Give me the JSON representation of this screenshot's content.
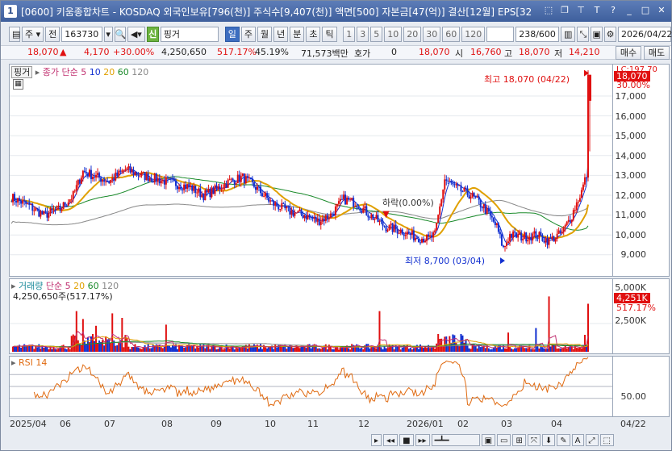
{
  "window": {
    "number": "1",
    "title": "[0600] 키움종합차트 - KOSDAQ 외국인보유[796(천)] 주식수[9,407(천)] 액면[500] 자본금[47(억)] 결산[12월] EPS[32"
  },
  "toolbar": {
    "period_type": "주",
    "market_label": "전",
    "code": "163730",
    "stock_name": "핑거",
    "credit_badge": "신",
    "periods": [
      "일",
      "주",
      "월",
      "년",
      "분",
      "초",
      "틱"
    ],
    "selected_period": "일",
    "intervals": [
      "1",
      "3",
      "5",
      "10",
      "20",
      "30",
      "60",
      "120"
    ],
    "count": "238/600",
    "date": "2026/04/22"
  },
  "quote": {
    "price": "18,070",
    "change": "4,170",
    "change_pct": "+30.00%",
    "volume": "4,250,650",
    "volume_ratio": "517.17%",
    "turnover_pct": "45.19%",
    "amount": "71,573백만",
    "hoga_label": "호가",
    "hoga_value": "0",
    "hoga_price": "18,070",
    "open_label": "시",
    "open": "16,760",
    "high_label": "고",
    "high": "18,070",
    "low_label": "저",
    "low": "14,210"
  },
  "price_pane": {
    "legend_name": "핑거",
    "legend_ma": "종가 단순 5",
    "ma_periods": [
      "10",
      "20",
      "60",
      "120"
    ],
    "y_ticks": [
      "17,000",
      "16,000",
      "15,000",
      "14,000",
      "13,000",
      "12,000",
      "11,000",
      "10,000",
      "9,000"
    ],
    "current_price_tag": "18,070",
    "current_pct_tag": "30.00%",
    "max_pct_tag": "LC:197.70",
    "high_annotation": "최고 18,070 (04/22)",
    "low_annotation": "최저 8,700 (03/04)",
    "mid_annotation": "하락(0.00%)",
    "buy_button": "매수",
    "sell_button": "매도"
  },
  "volume_pane": {
    "legend_name": "거래량",
    "legend_ma": "단순 5",
    "ma_periods": [
      "20",
      "60",
      "120"
    ],
    "sub_label": "4,250,650주(517.17%)",
    "y_ticks": [
      "5,000K",
      "2,500K"
    ],
    "current_tag": "4,251K",
    "pct_tag": "517.17%"
  },
  "rsi_pane": {
    "legend_name": "RSI 14",
    "y_ticks": [
      "50.00"
    ]
  },
  "x_axis": {
    "labels": [
      "2025/04",
      "06",
      "07",
      "08",
      "09",
      "10",
      "11",
      "12",
      "2026/01",
      "02",
      "03",
      "04"
    ],
    "right_label": "04/22"
  },
  "colors": {
    "up": "#e01010",
    "down": "#1230d0",
    "ma5": "#1230d0",
    "ma20": "#e0a000",
    "ma60": "#1a8a2a",
    "ma120": "#888888",
    "rsi": "#e06a10"
  }
}
